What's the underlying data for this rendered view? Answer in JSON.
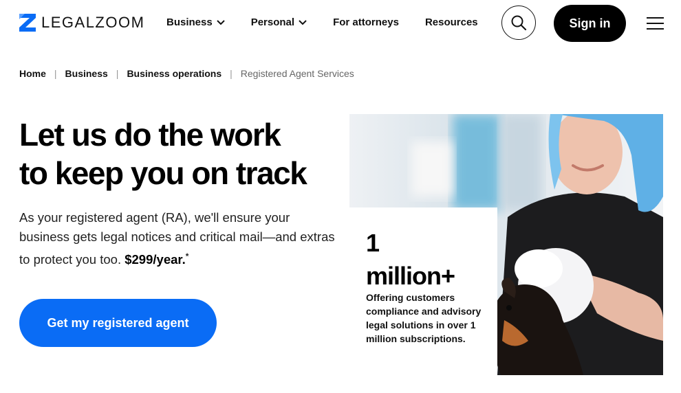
{
  "brand": {
    "name": "LEGALZOOM",
    "accent": "#0a6cf5"
  },
  "nav": {
    "items": [
      {
        "label": "Business",
        "has_dropdown": true
      },
      {
        "label": "Personal",
        "has_dropdown": true
      },
      {
        "label": "For attorneys",
        "has_dropdown": false
      },
      {
        "label": "Resources",
        "has_dropdown": false
      }
    ],
    "search_icon": "search-icon",
    "signin_label": "Sign in",
    "menu_icon": "hamburger-menu-icon"
  },
  "breadcrumb": [
    "Home",
    "Business",
    "Business operations",
    "Registered Agent Services"
  ],
  "hero": {
    "headline_line1": "Let us do the work",
    "headline_line2": "to keep you on track",
    "subcopy": "As your registered agent (RA), we'll ensure your business gets legal notices and critical mail—and extras to protect you too.",
    "price": "$299/year.",
    "footnote_mark": "*",
    "cta_label": "Get my registered agent"
  },
  "stat": {
    "number_line1": "1",
    "number_line2": "million+",
    "description": "Offering customers compliance and advisory legal solutions in over 1 million subscriptions."
  }
}
